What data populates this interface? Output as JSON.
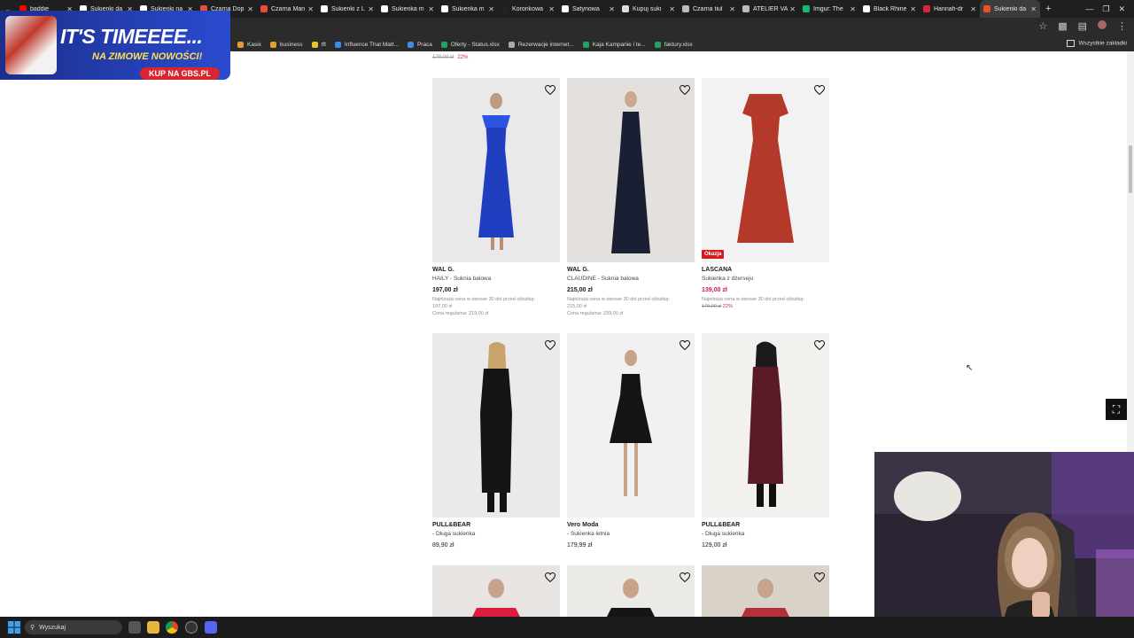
{
  "tabs": [
    {
      "title": "baddie",
      "color": "#ff0000",
      "active": false
    },
    {
      "title": "Sukienki da",
      "color": "#ffffff",
      "active": false
    },
    {
      "title": "Sukienki na",
      "color": "#ffffff",
      "active": false
    },
    {
      "title": "Czarna Dop",
      "color": "#e74c3c",
      "active": false
    },
    {
      "title": "Czarna Man",
      "color": "#e74c3c",
      "active": false
    },
    {
      "title": "Sukienki z L",
      "color": "#ffffff",
      "active": false
    },
    {
      "title": "Sukienka m",
      "color": "#ffffff",
      "active": false
    },
    {
      "title": "Sukienka m",
      "color": "#ffffff",
      "active": false
    },
    {
      "title": "Koronkowa",
      "color": "#222222",
      "active": false
    },
    {
      "title": "Satynowa",
      "color": "#ffffff",
      "active": false
    },
    {
      "title": "Kupuj suki",
      "color": "#dddddd",
      "active": false
    },
    {
      "title": "Czarna tiul",
      "color": "#bbbbbb",
      "active": false
    },
    {
      "title": "ATELIER VA",
      "color": "#bbbbbb",
      "active": false
    },
    {
      "title": "Imgur: The",
      "color": "#1bb76e",
      "active": false
    },
    {
      "title": "Black Rhine",
      "color": "#ffffff",
      "active": false
    },
    {
      "title": "Hannah-dr",
      "color": "#e02040",
      "active": false
    },
    {
      "title": "Sukienki da",
      "color": "#f04e23",
      "active": true
    }
  ],
  "bookmarks": [
    {
      "label": "Kasix",
      "color": "#e89b2f"
    },
    {
      "label": "business",
      "color": "#e89b2f"
    },
    {
      "label": "tft",
      "color": "#e8c22f"
    },
    {
      "label": "Influence That Matt...",
      "color": "#3c8ce7"
    },
    {
      "label": "Praca",
      "color": "#3c8ce7"
    },
    {
      "label": "Oferty - Status.xlsx",
      "color": "#21a366"
    },
    {
      "label": "Rezerwacje internet...",
      "color": "#aaaaaa"
    },
    {
      "label": "Kaja Kampanie i te...",
      "color": "#21a366"
    },
    {
      "label": "faktury.xlsx",
      "color": "#21a366"
    }
  ],
  "bookmarks_all": "Wszystkie zakładki",
  "ad": {
    "line1": "IT'S TIMEEEE...",
    "line2": "NA ZIMOWE NOWOŚCI!",
    "cta": "KUP NA GBS.PL"
  },
  "prev_row": {
    "old": "179,00 zł",
    "disc": "22%"
  },
  "products": [
    {
      "brand": "WAL G.",
      "name": "HAILY - Suknia balowa",
      "price": "197,00 zł",
      "sale": false,
      "note1": "Najniższa cena w okresie 30 dni przed obniżką:",
      "note2": "197,00 zł",
      "note3": "Cena regularna: 219,00 zł",
      "old": "",
      "disc": "",
      "badge": ""
    },
    {
      "brand": "WAL G.",
      "name": "CLAUDINE - Suknia balowa",
      "price": "215,00 zł",
      "sale": false,
      "note1": "Najniższa cena w okresie 30 dni przed obniżką:",
      "note2": "215,00 zł",
      "note3": "Cena regularna: 239,00 zł",
      "old": "",
      "disc": "",
      "badge": ""
    },
    {
      "brand": "LASCANA",
      "name": "Sukienka z dżerseju",
      "price": "139,00 zł",
      "sale": true,
      "note1": "Najniższa cena w okresie 30 dni przed obniżką:",
      "note2": "",
      "note3": "",
      "old": "179,00 zł",
      "disc": "22%",
      "badge": "Okazja"
    },
    {
      "brand": "PULL&BEAR",
      "name": "- Długa sukienka",
      "price": "89,90 zł",
      "sale": false,
      "note1": "",
      "note2": "",
      "note3": "",
      "old": "",
      "disc": "",
      "badge": ""
    },
    {
      "brand": "Vero Moda",
      "name": "- Sukienka letnia",
      "price": "179,99 zł",
      "sale": false,
      "note1": "",
      "note2": "",
      "note3": "",
      "old": "",
      "disc": "",
      "badge": ""
    },
    {
      "brand": "PULL&BEAR",
      "name": "- Długa sukienka",
      "price": "129,00 zł",
      "sale": false,
      "note1": "",
      "note2": "",
      "note3": "",
      "old": "",
      "disc": "",
      "badge": ""
    }
  ],
  "taskbar": {
    "search_placeholder": "Wyszukaj"
  },
  "colors": {
    "sale": "#d21c4c",
    "badge": "#d21c1c"
  }
}
